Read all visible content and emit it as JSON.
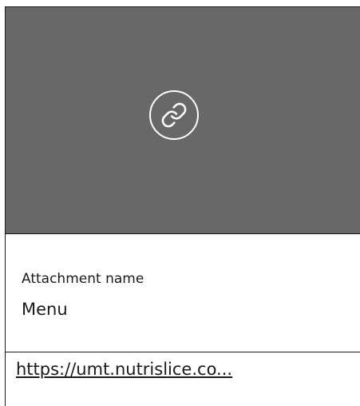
{
  "preview": {
    "icon": "link-icon",
    "background_color": "#686868"
  },
  "attachment": {
    "name_label": "Attachment name",
    "name_value": "Menu",
    "url": "https://umt.nutrislice.co..."
  }
}
